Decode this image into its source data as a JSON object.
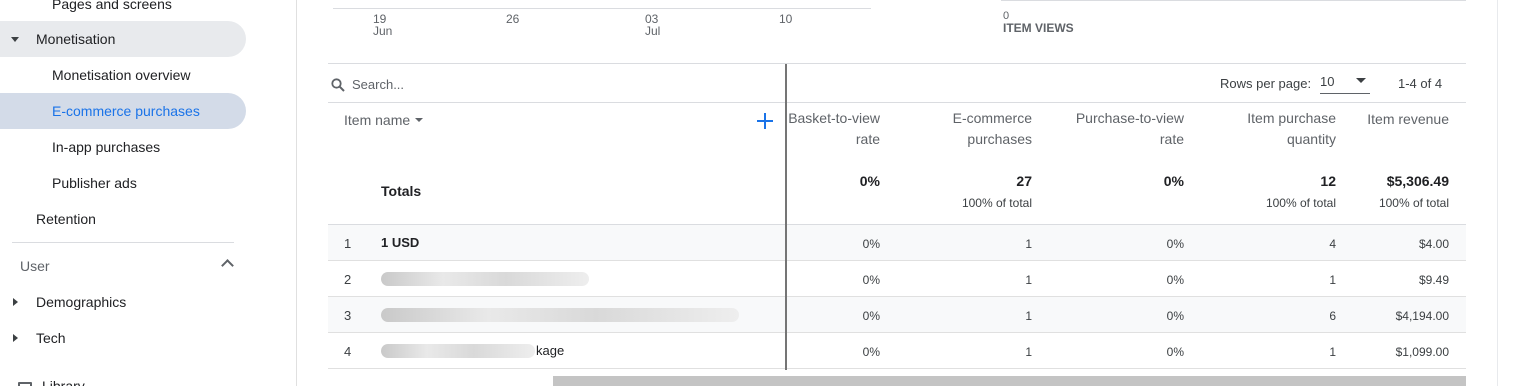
{
  "sidebar": {
    "pages_and_screens": "Pages and screens",
    "monetisation": "Monetisation",
    "monetisation_overview": "Monetisation overview",
    "ecommerce_purchases": "E-commerce purchases",
    "in_app_purchases": "In-app purchases",
    "publisher_ads": "Publisher ads",
    "retention": "Retention",
    "user_section": "User",
    "demographics": "Demographics",
    "tech": "Tech",
    "library": "Library"
  },
  "chart": {
    "x_ticks": [
      {
        "day": "19",
        "month": "Jun"
      },
      {
        "day": "26",
        "month": ""
      },
      {
        "day": "03",
        "month": "Jul"
      },
      {
        "day": "10",
        "month": ""
      }
    ],
    "mini_zero": "0",
    "mini_label": "ITEM VIEWS"
  },
  "table": {
    "search_placeholder": "Search...",
    "rows_per_page_label": "Rows per page:",
    "rows_per_page_value": "10",
    "range_text": "1-4 of 4",
    "item_name_header": "Item name",
    "columns": [
      {
        "line1": "Basket-to-view",
        "line2": "rate"
      },
      {
        "line1": "E-commerce",
        "line2": "purchases"
      },
      {
        "line1": "Purchase-to-view",
        "line2": "rate"
      },
      {
        "line1": "Item purchase",
        "line2": "quantity"
      },
      {
        "line1": "Item revenue",
        "line2": ""
      }
    ],
    "totals_label": "Totals",
    "totals": [
      {
        "value": "0%",
        "sub": ""
      },
      {
        "value": "27",
        "sub": "100% of total"
      },
      {
        "value": "0%",
        "sub": ""
      },
      {
        "value": "12",
        "sub": "100% of total"
      },
      {
        "value": "$5,306.49",
        "sub": "100% of total"
      }
    ],
    "rows": [
      {
        "index": "1",
        "name": "1 USD",
        "cells": [
          "0%",
          "1",
          "0%",
          "4",
          "$4.00"
        ]
      },
      {
        "index": "2",
        "name": "",
        "cells": [
          "0%",
          "1",
          "0%",
          "1",
          "$9.49"
        ]
      },
      {
        "index": "3",
        "name": "",
        "cells": [
          "0%",
          "1",
          "0%",
          "6",
          "$4,194.00"
        ]
      },
      {
        "index": "4",
        "name": "kage",
        "cells": [
          "0%",
          "1",
          "0%",
          "1",
          "$1,099.00"
        ]
      }
    ]
  },
  "colors": {
    "accent": "#1a73e8",
    "active_bg": "#d3dbe8",
    "group_bg": "#e8eaed"
  }
}
